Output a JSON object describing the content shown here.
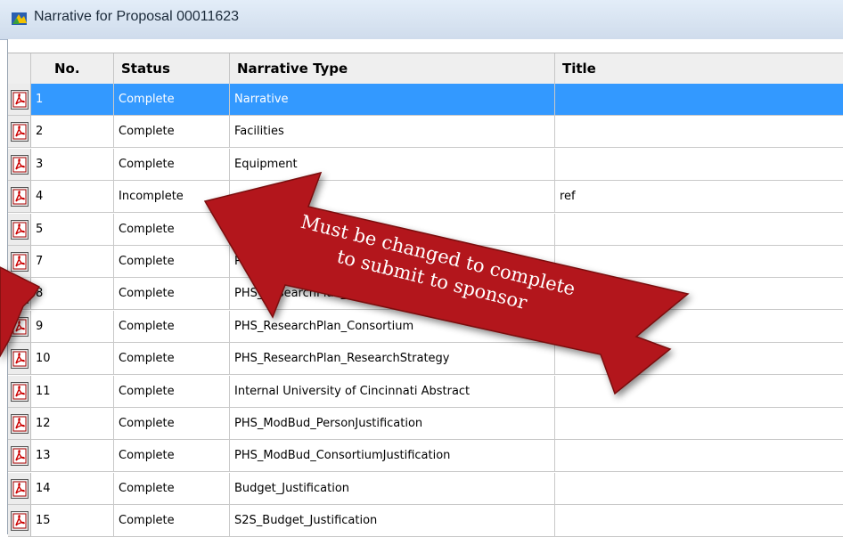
{
  "window": {
    "title": "Narrative for Proposal  00011623"
  },
  "table": {
    "columns": [
      "No.",
      "Status",
      "Narrative Type",
      "Title"
    ],
    "rows": [
      {
        "no": "1",
        "status": "Complete",
        "type": "Narrative",
        "title": "",
        "selected": true
      },
      {
        "no": "2",
        "status": "Complete",
        "type": "Facilities",
        "title": ""
      },
      {
        "no": "3",
        "status": "Complete",
        "type": "Equipment",
        "title": ""
      },
      {
        "no": "4",
        "status": "Incomplete",
        "type": "",
        "title": "ref"
      },
      {
        "no": "5",
        "status": "Complete",
        "type": "",
        "title": ""
      },
      {
        "no": "7",
        "status": "Complete",
        "type": "PHS_",
        "title": ""
      },
      {
        "no": "8",
        "status": "Complete",
        "type": "PHS_ResearchPlan_",
        "title": ""
      },
      {
        "no": "9",
        "status": "Complete",
        "type": "PHS_ResearchPlan_Consortium",
        "title": ""
      },
      {
        "no": "10",
        "status": "Complete",
        "type": "PHS_ResearchPlan_ResearchStrategy",
        "title": ""
      },
      {
        "no": "11",
        "status": "Complete",
        "type": "Internal University of Cincinnati Abstract",
        "title": ""
      },
      {
        "no": "12",
        "status": "Complete",
        "type": "PHS_ModBud_PersonJustification",
        "title": ""
      },
      {
        "no": "13",
        "status": "Complete",
        "type": "PHS_ModBud_ConsortiumJustification",
        "title": ""
      },
      {
        "no": "14",
        "status": "Complete",
        "type": "Budget_Justification",
        "title": ""
      },
      {
        "no": "15",
        "status": "Complete",
        "type": "S2S_Budget_Justification",
        "title": ""
      }
    ]
  },
  "annotation": {
    "line1": "Must be changed to complete",
    "line2": "to submit to sponsor"
  },
  "colors": {
    "selection": "#3399ff",
    "arrow": "#b3191c"
  },
  "icons": {
    "title_icon": "app-icon",
    "row_icon": "pdf-icon"
  }
}
